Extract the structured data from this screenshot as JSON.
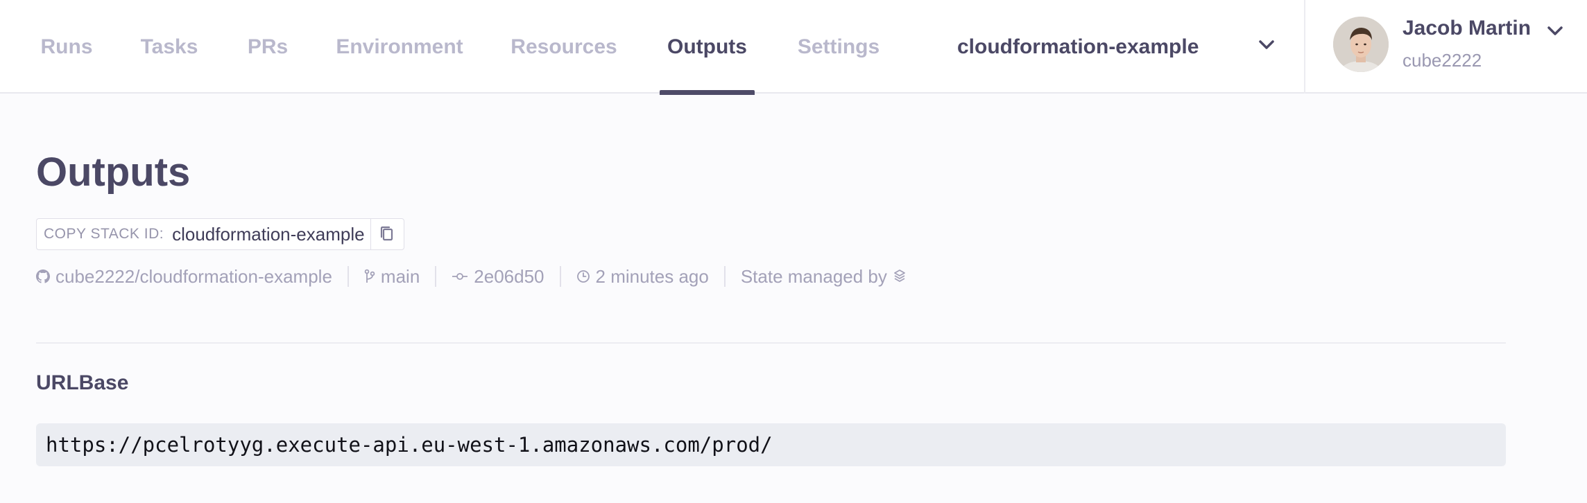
{
  "nav": {
    "tabs": [
      {
        "label": "Runs",
        "active": false
      },
      {
        "label": "Tasks",
        "active": false
      },
      {
        "label": "PRs",
        "active": false
      },
      {
        "label": "Environment",
        "active": false
      },
      {
        "label": "Resources",
        "active": false
      },
      {
        "label": "Outputs",
        "active": true
      },
      {
        "label": "Settings",
        "active": false
      }
    ],
    "stack_selector": {
      "value": "cloudformation-example",
      "icon": "chevron-down-icon"
    }
  },
  "user": {
    "name": "Jacob Martin",
    "handle": "cube2222",
    "icon": "chevron-down-icon"
  },
  "page": {
    "title": "Outputs",
    "copy_stack": {
      "label": "COPY STACK ID:",
      "value": "cloudformation-example",
      "icon": "copy-icon"
    },
    "meta": {
      "repo": "cube2222/cloudformation-example",
      "branch": "main",
      "commit": "2e06d50",
      "time": "2 minutes ago",
      "state": "State managed by"
    }
  },
  "outputs": [
    {
      "key": "URLBase",
      "value": "https://pcelrotyyg.execute-api.eu-west-1.amazonaws.com/prod/"
    }
  ],
  "colors": {
    "text_primary": "#4b4865",
    "text_muted": "#a3a1b8",
    "tab_inactive": "#b9b8cc",
    "active_underline": "#4e4b68",
    "code_bg": "#ebedf2"
  }
}
